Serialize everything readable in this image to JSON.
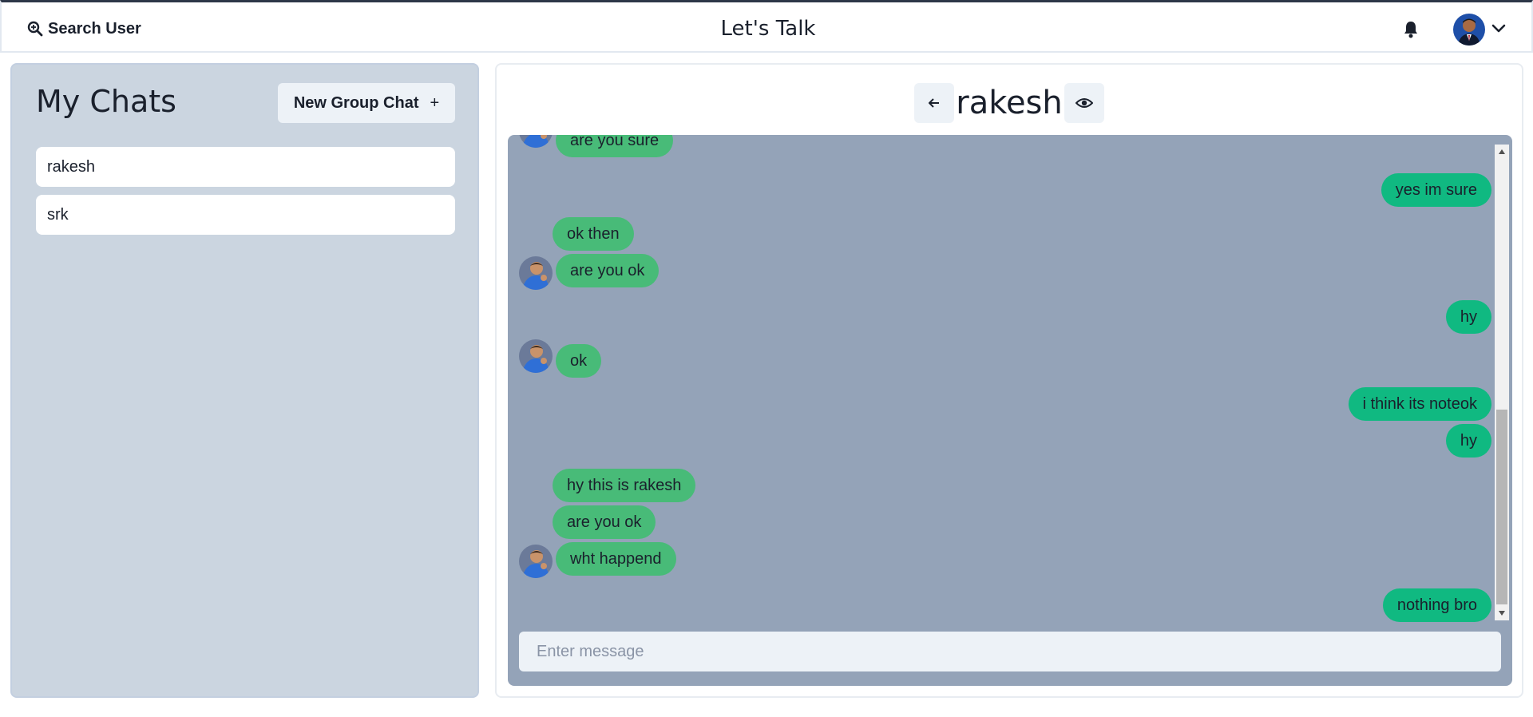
{
  "topbar": {
    "search_label": "Search User",
    "app_title": "Let's Talk"
  },
  "left": {
    "title": "My Chats",
    "new_group_label": "New Group Chat",
    "new_group_icon": "+",
    "chats": [
      {
        "name": "rakesh"
      },
      {
        "name": "srk"
      }
    ]
  },
  "chat": {
    "name": "rakesh",
    "messages": [
      {
        "text": "are you sure",
        "from": "them",
        "avatar": true
      },
      {
        "text": "yes im sure",
        "from": "me"
      },
      {
        "text": "ok then",
        "from": "them",
        "avatar": false
      },
      {
        "text": "are you ok",
        "from": "them",
        "avatar": true
      },
      {
        "text": "hy",
        "from": "me"
      },
      {
        "text": "ok",
        "from": "them",
        "avatar": true
      },
      {
        "text": "i think its noteok",
        "from": "me"
      },
      {
        "text": "hy",
        "from": "me"
      },
      {
        "text": "hy this is rakesh",
        "from": "them",
        "avatar": false
      },
      {
        "text": "are you ok",
        "from": "them",
        "avatar": false
      },
      {
        "text": "wht happend",
        "from": "them",
        "avatar": true
      },
      {
        "text": "nothing bro",
        "from": "me"
      }
    ],
    "input_placeholder": "Enter message",
    "input_value": ""
  },
  "colors": {
    "incoming_bubble": "#48bb78",
    "outgoing_bubble": "#10b981",
    "messages_bg": "#94a3b8",
    "left_panel_bg": "#cbd5e0"
  },
  "icons": {
    "search": "search-icon",
    "bell": "bell-icon",
    "chevron": "chevron-down-icon",
    "back": "arrow-left-icon",
    "view": "eye-icon"
  }
}
